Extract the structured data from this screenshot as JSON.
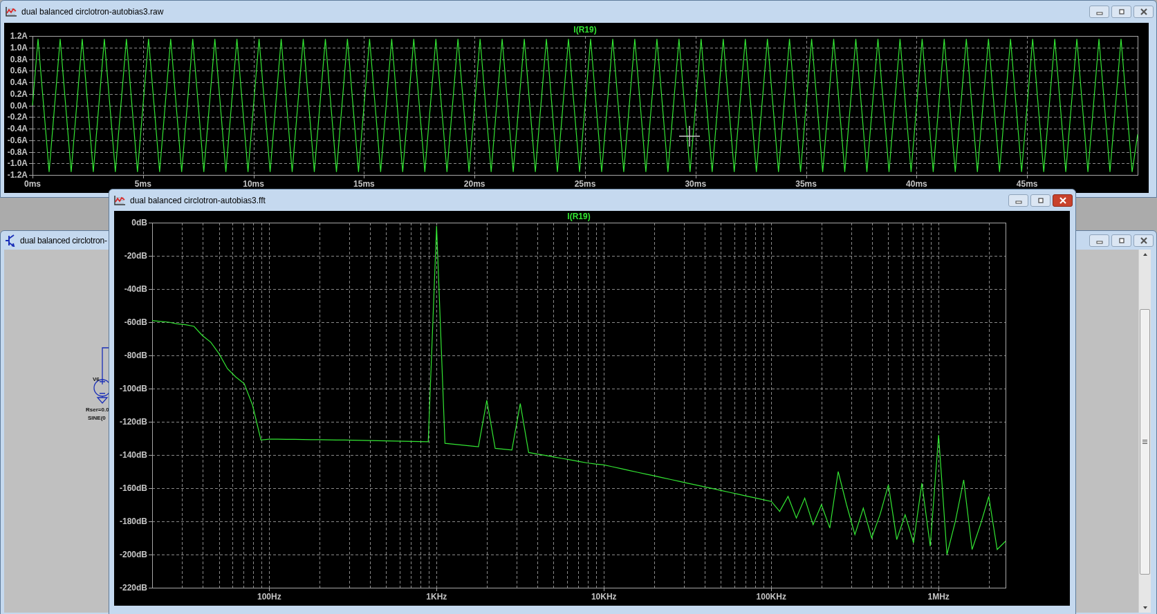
{
  "windows": [
    {
      "kind": "plot",
      "title": "dual balanced circlotron-autobias3.raw",
      "active": false,
      "chart_data": {
        "type": "line",
        "grid": true,
        "xlim": [
          0,
          50
        ],
        "ylim": [
          -1.2,
          1.2
        ],
        "xticks": [
          {
            "value": 0,
            "label": "0ms"
          },
          {
            "value": 5,
            "label": "5ms"
          },
          {
            "value": 10,
            "label": "10ms"
          },
          {
            "value": 15,
            "label": "15ms"
          },
          {
            "value": 20,
            "label": "20ms"
          },
          {
            "value": 25,
            "label": "25ms"
          },
          {
            "value": 30,
            "label": "30ms"
          },
          {
            "value": 35,
            "label": "35ms"
          },
          {
            "value": 40,
            "label": "40ms"
          },
          {
            "value": 45,
            "label": "45ms"
          }
        ],
        "yticks": [
          {
            "value": 1.2,
            "label": "1.2A"
          },
          {
            "value": 1.0,
            "label": "1.0A"
          },
          {
            "value": 0.8,
            "label": "0.8A"
          },
          {
            "value": 0.6,
            "label": "0.6A"
          },
          {
            "value": 0.4,
            "label": "0.4A"
          },
          {
            "value": 0.2,
            "label": "0.2A"
          },
          {
            "value": 0,
            "label": "0.0A"
          },
          {
            "value": -0.2,
            "label": "-0.2A"
          },
          {
            "value": -0.4,
            "label": "-0.4A"
          },
          {
            "value": -0.6,
            "label": "-0.6A"
          },
          {
            "value": -0.8,
            "label": "-0.8A"
          },
          {
            "value": -1.0,
            "label": "-1.0A"
          },
          {
            "value": -1.2,
            "label": "-1.2A"
          }
        ],
        "x": [
          0,
          0.25,
          0.75,
          1.25,
          1.75,
          2.25,
          2.75,
          3.25,
          3.75,
          4.25,
          4.75,
          5.25,
          5.75,
          6.25,
          6.75,
          7.25,
          7.75,
          8.25,
          8.75,
          9.25,
          9.75,
          10.25,
          10.75,
          11.25,
          11.75,
          12.25,
          12.75,
          13.25,
          13.75,
          14.25,
          14.75,
          15.25,
          15.75,
          16.25,
          16.75,
          17.25,
          17.75,
          18.25,
          18.75,
          19.25,
          19.75,
          20.25,
          20.75,
          21.25,
          21.75,
          22.25,
          22.75,
          23.25,
          23.75,
          24.25,
          24.75,
          25.25,
          25.75,
          26.25,
          26.75,
          27.25,
          27.75,
          28.25,
          28.75,
          29.25,
          29.75,
          30.25,
          30.75,
          31.25,
          31.75,
          32.25,
          32.75,
          33.25,
          33.75,
          34.25,
          34.75,
          35.25,
          35.75,
          36.25,
          36.75,
          37.25,
          37.75,
          38.25,
          38.75,
          39.25,
          39.75,
          40.25,
          40.75,
          41.25,
          41.75,
          42.25,
          42.75,
          43.25,
          43.75,
          44.25,
          44.75,
          45.25,
          45.75,
          46.25,
          46.75,
          47.25,
          47.75,
          48.25,
          48.75,
          49.25,
          49.75,
          50
        ],
        "series": [
          {
            "name": "I(R19)",
            "color": "#33e633",
            "values": [
              0,
              1.15,
              -1.15,
              1.15,
              -1.15,
              1.15,
              -1.15,
              1.15,
              -1.15,
              1.15,
              -1.15,
              1.15,
              -1.15,
              1.15,
              -1.15,
              1.15,
              -1.15,
              1.15,
              -1.15,
              1.15,
              -1.15,
              1.15,
              -1.15,
              1.15,
              -1.15,
              1.15,
              -1.15,
              1.15,
              -1.15,
              1.15,
              -1.15,
              1.15,
              -1.15,
              1.15,
              -1.15,
              1.15,
              -1.15,
              1.15,
              -1.15,
              1.15,
              -1.15,
              1.15,
              -1.15,
              1.15,
              -1.15,
              1.15,
              -1.15,
              1.15,
              -1.15,
              1.15,
              -1.15,
              1.15,
              -1.15,
              1.15,
              -1.15,
              1.15,
              -1.15,
              1.15,
              -1.15,
              1.15,
              -1.15,
              1.15,
              -1.15,
              1.15,
              -1.15,
              1.15,
              -1.15,
              1.15,
              -1.15,
              1.15,
              -1.15,
              1.15,
              -1.15,
              1.15,
              -1.15,
              1.15,
              -1.15,
              1.15,
              -1.15,
              1.15,
              -1.15,
              1.15,
              -1.15,
              1.15,
              -1.15,
              1.15,
              -1.15,
              1.15,
              -1.15,
              1.15,
              -1.15,
              1.15,
              -1.15,
              1.15,
              -1.15,
              1.15,
              -1.15,
              1.15,
              -1.15,
              1.15,
              -1.15,
              -0.5
            ]
          }
        ]
      }
    },
    {
      "kind": "schematic",
      "title": "dual balanced circlotron-",
      "active": false,
      "labels": [
        "V6",
        "Rser=0.0",
        "SINE(0"
      ]
    },
    {
      "kind": "plot",
      "title": "dual balanced circlotron-autobias3.fft",
      "active": true,
      "chart_data": {
        "type": "line",
        "grid": true,
        "ylim": [
          -220,
          0
        ],
        "categories": [
          null,
          null,
          null,
          null,
          null,
          null,
          null,
          null,
          null,
          null,
          null,
          null,
          null,
          null,
          "100Hz",
          null,
          null,
          null,
          null,
          null,
          null,
          null,
          null,
          null,
          null,
          null,
          null,
          null,
          null,
          null,
          null,
          null,
          null,
          null,
          "1KHz",
          null,
          null,
          null,
          null,
          null,
          null,
          null,
          null,
          null,
          null,
          null,
          null,
          null,
          null,
          null,
          null,
          null,
          null,
          null,
          "10KHz",
          null,
          null,
          null,
          null,
          null,
          null,
          null,
          null,
          null,
          null,
          null,
          null,
          null,
          null,
          null,
          null,
          null,
          null,
          null,
          "100KHz",
          null,
          null,
          null,
          null,
          null,
          null,
          null,
          null,
          null,
          null,
          null,
          null,
          null,
          null,
          null,
          null,
          null,
          null,
          null,
          "1MHz",
          null,
          null,
          null,
          null,
          null,
          null,
          null,
          null
        ],
        "yticks": [
          {
            "value": 0,
            "label": "0dB"
          },
          {
            "value": -20,
            "label": "-20dB"
          },
          {
            "value": -40,
            "label": "-40dB"
          },
          {
            "value": -60,
            "label": "-60dB"
          },
          {
            "value": -80,
            "label": "-80dB"
          },
          {
            "value": -100,
            "label": "-100dB"
          },
          {
            "value": -120,
            "label": "-120dB"
          },
          {
            "value": -140,
            "label": "-140dB"
          },
          {
            "value": -160,
            "label": "-160dB"
          },
          {
            "value": -180,
            "label": "-180dB"
          },
          {
            "value": -200,
            "label": "-200dB"
          },
          {
            "value": -220,
            "label": "-220dB"
          }
        ],
        "series": [
          {
            "name": "I(R19)",
            "color": "#33e633",
            "values": [
              -59,
              -59.5,
              -60,
              -61,
              -61.5,
              -62.5,
              -68,
              -72,
              -79,
              -88,
              -93,
              -97,
              -110,
              -131,
              -130.5,
              -130.5,
              -130.6,
              -130.6,
              -130.7,
              -130.8,
              -130.8,
              -130.9,
              -131,
              -131,
              -131.1,
              -131.2,
              -131.3,
              -131.4,
              -131.5,
              -131.6,
              -131.7,
              -131.8,
              -131.9,
              -132,
              -2,
              -133,
              -133.5,
              -134,
              -134.5,
              -135,
              -107,
              -136,
              -136.5,
              -137,
              -109,
              -138.5,
              -139.4,
              -140.3,
              -141.2,
              -142.1,
              -143,
              -143.9,
              -144.8,
              -145.5,
              -146,
              -147.1,
              -148.2,
              -149.3,
              -150.4,
              -151.5,
              -152.6,
              -153.7,
              -154.8,
              -155.9,
              -157,
              -158.1,
              -159.2,
              -160.3,
              -161.4,
              -162.5,
              -163.6,
              -164.7,
              -165.8,
              -166.9,
              -168,
              -174,
              -165,
              -178,
              -166,
              -182,
              -170,
              -184,
              -150,
              -170,
              -188,
              -172,
              -190,
              -176,
              -158,
              -191,
              -176,
              -193,
              -157,
              -195,
              -128,
              -200,
              -180,
              -155,
              -197,
              -182,
              -165,
              -197,
              -192
            ]
          }
        ]
      }
    }
  ]
}
